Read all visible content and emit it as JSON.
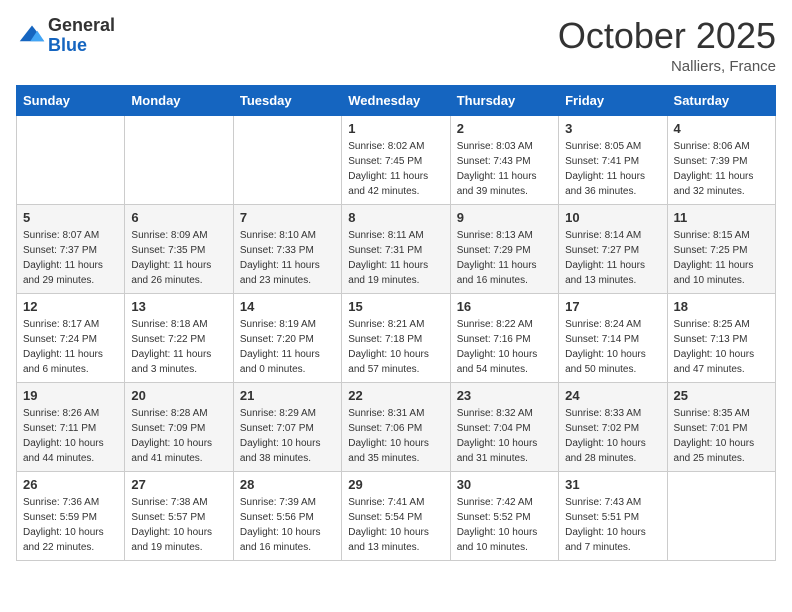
{
  "header": {
    "logo_general": "General",
    "logo_blue": "Blue",
    "month_title": "October 2025",
    "location": "Nalliers, France"
  },
  "weekdays": [
    "Sunday",
    "Monday",
    "Tuesday",
    "Wednesday",
    "Thursday",
    "Friday",
    "Saturday"
  ],
  "weeks": [
    [
      {
        "day": "",
        "sunrise": "",
        "sunset": "",
        "daylight": ""
      },
      {
        "day": "",
        "sunrise": "",
        "sunset": "",
        "daylight": ""
      },
      {
        "day": "",
        "sunrise": "",
        "sunset": "",
        "daylight": ""
      },
      {
        "day": "1",
        "sunrise": "Sunrise: 8:02 AM",
        "sunset": "Sunset: 7:45 PM",
        "daylight": "Daylight: 11 hours and 42 minutes."
      },
      {
        "day": "2",
        "sunrise": "Sunrise: 8:03 AM",
        "sunset": "Sunset: 7:43 PM",
        "daylight": "Daylight: 11 hours and 39 minutes."
      },
      {
        "day": "3",
        "sunrise": "Sunrise: 8:05 AM",
        "sunset": "Sunset: 7:41 PM",
        "daylight": "Daylight: 11 hours and 36 minutes."
      },
      {
        "day": "4",
        "sunrise": "Sunrise: 8:06 AM",
        "sunset": "Sunset: 7:39 PM",
        "daylight": "Daylight: 11 hours and 32 minutes."
      }
    ],
    [
      {
        "day": "5",
        "sunrise": "Sunrise: 8:07 AM",
        "sunset": "Sunset: 7:37 PM",
        "daylight": "Daylight: 11 hours and 29 minutes."
      },
      {
        "day": "6",
        "sunrise": "Sunrise: 8:09 AM",
        "sunset": "Sunset: 7:35 PM",
        "daylight": "Daylight: 11 hours and 26 minutes."
      },
      {
        "day": "7",
        "sunrise": "Sunrise: 8:10 AM",
        "sunset": "Sunset: 7:33 PM",
        "daylight": "Daylight: 11 hours and 23 minutes."
      },
      {
        "day": "8",
        "sunrise": "Sunrise: 8:11 AM",
        "sunset": "Sunset: 7:31 PM",
        "daylight": "Daylight: 11 hours and 19 minutes."
      },
      {
        "day": "9",
        "sunrise": "Sunrise: 8:13 AM",
        "sunset": "Sunset: 7:29 PM",
        "daylight": "Daylight: 11 hours and 16 minutes."
      },
      {
        "day": "10",
        "sunrise": "Sunrise: 8:14 AM",
        "sunset": "Sunset: 7:27 PM",
        "daylight": "Daylight: 11 hours and 13 minutes."
      },
      {
        "day": "11",
        "sunrise": "Sunrise: 8:15 AM",
        "sunset": "Sunset: 7:25 PM",
        "daylight": "Daylight: 11 hours and 10 minutes."
      }
    ],
    [
      {
        "day": "12",
        "sunrise": "Sunrise: 8:17 AM",
        "sunset": "Sunset: 7:24 PM",
        "daylight": "Daylight: 11 hours and 6 minutes."
      },
      {
        "day": "13",
        "sunrise": "Sunrise: 8:18 AM",
        "sunset": "Sunset: 7:22 PM",
        "daylight": "Daylight: 11 hours and 3 minutes."
      },
      {
        "day": "14",
        "sunrise": "Sunrise: 8:19 AM",
        "sunset": "Sunset: 7:20 PM",
        "daylight": "Daylight: 11 hours and 0 minutes."
      },
      {
        "day": "15",
        "sunrise": "Sunrise: 8:21 AM",
        "sunset": "Sunset: 7:18 PM",
        "daylight": "Daylight: 10 hours and 57 minutes."
      },
      {
        "day": "16",
        "sunrise": "Sunrise: 8:22 AM",
        "sunset": "Sunset: 7:16 PM",
        "daylight": "Daylight: 10 hours and 54 minutes."
      },
      {
        "day": "17",
        "sunrise": "Sunrise: 8:24 AM",
        "sunset": "Sunset: 7:14 PM",
        "daylight": "Daylight: 10 hours and 50 minutes."
      },
      {
        "day": "18",
        "sunrise": "Sunrise: 8:25 AM",
        "sunset": "Sunset: 7:13 PM",
        "daylight": "Daylight: 10 hours and 47 minutes."
      }
    ],
    [
      {
        "day": "19",
        "sunrise": "Sunrise: 8:26 AM",
        "sunset": "Sunset: 7:11 PM",
        "daylight": "Daylight: 10 hours and 44 minutes."
      },
      {
        "day": "20",
        "sunrise": "Sunrise: 8:28 AM",
        "sunset": "Sunset: 7:09 PM",
        "daylight": "Daylight: 10 hours and 41 minutes."
      },
      {
        "day": "21",
        "sunrise": "Sunrise: 8:29 AM",
        "sunset": "Sunset: 7:07 PM",
        "daylight": "Daylight: 10 hours and 38 minutes."
      },
      {
        "day": "22",
        "sunrise": "Sunrise: 8:31 AM",
        "sunset": "Sunset: 7:06 PM",
        "daylight": "Daylight: 10 hours and 35 minutes."
      },
      {
        "day": "23",
        "sunrise": "Sunrise: 8:32 AM",
        "sunset": "Sunset: 7:04 PM",
        "daylight": "Daylight: 10 hours and 31 minutes."
      },
      {
        "day": "24",
        "sunrise": "Sunrise: 8:33 AM",
        "sunset": "Sunset: 7:02 PM",
        "daylight": "Daylight: 10 hours and 28 minutes."
      },
      {
        "day": "25",
        "sunrise": "Sunrise: 8:35 AM",
        "sunset": "Sunset: 7:01 PM",
        "daylight": "Daylight: 10 hours and 25 minutes."
      }
    ],
    [
      {
        "day": "26",
        "sunrise": "Sunrise: 7:36 AM",
        "sunset": "Sunset: 5:59 PM",
        "daylight": "Daylight: 10 hours and 22 minutes."
      },
      {
        "day": "27",
        "sunrise": "Sunrise: 7:38 AM",
        "sunset": "Sunset: 5:57 PM",
        "daylight": "Daylight: 10 hours and 19 minutes."
      },
      {
        "day": "28",
        "sunrise": "Sunrise: 7:39 AM",
        "sunset": "Sunset: 5:56 PM",
        "daylight": "Daylight: 10 hours and 16 minutes."
      },
      {
        "day": "29",
        "sunrise": "Sunrise: 7:41 AM",
        "sunset": "Sunset: 5:54 PM",
        "daylight": "Daylight: 10 hours and 13 minutes."
      },
      {
        "day": "30",
        "sunrise": "Sunrise: 7:42 AM",
        "sunset": "Sunset: 5:52 PM",
        "daylight": "Daylight: 10 hours and 10 minutes."
      },
      {
        "day": "31",
        "sunrise": "Sunrise: 7:43 AM",
        "sunset": "Sunset: 5:51 PM",
        "daylight": "Daylight: 10 hours and 7 minutes."
      },
      {
        "day": "",
        "sunrise": "",
        "sunset": "",
        "daylight": ""
      }
    ]
  ]
}
